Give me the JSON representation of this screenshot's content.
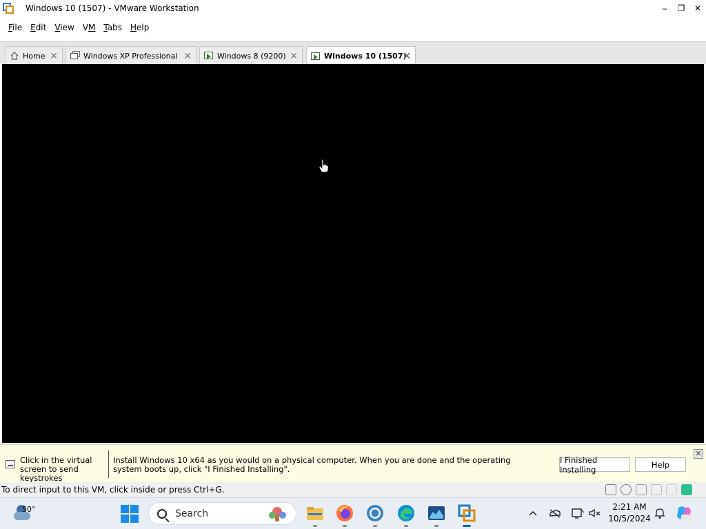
{
  "window": {
    "title": "Windows 10 (1507) - VMware Workstation",
    "controls": [
      "–",
      "❐",
      "✕"
    ]
  },
  "menu": {
    "items": [
      {
        "label": "File",
        "accel": "F"
      },
      {
        "label": "Edit",
        "accel": "E"
      },
      {
        "label": "View",
        "accel": "V"
      },
      {
        "label": "VM",
        "accel": "M"
      },
      {
        "label": "Tabs",
        "accel": "T"
      },
      {
        "label": "Help",
        "accel": "H"
      }
    ]
  },
  "tabs": [
    {
      "label": "Home",
      "icon": "home-icon",
      "active": false
    },
    {
      "label": "Windows XP Professional",
      "icon": "vm-icon",
      "active": false
    },
    {
      "label": "Windows 8 (9200)",
      "icon": "vm-running-icon",
      "active": false
    },
    {
      "label": "Windows 10 (1507)",
      "icon": "vm-running-icon",
      "active": true
    }
  ],
  "infobar": {
    "hint": "Click in the virtual screen to send keystrokes",
    "message": "Install Windows 10 x64 as you would on a physical computer. When you are done and the operating system boots up, click \"I Finished Installing\".",
    "finished_button": "I Finished Installing",
    "help_button": "Help"
  },
  "statusbar": {
    "text": "To direct input to this VM, click inside or press Ctrl+G."
  },
  "taskbar": {
    "weather_temp": "50°",
    "search_label": "Search",
    "apps": [
      "file-explorer-icon",
      "firefox-icon",
      "chrome-icon",
      "edge-icon",
      "app-icon",
      "vmware-icon"
    ],
    "clock_time": "2:21 AM",
    "clock_date": "10/5/2024"
  },
  "colors": {
    "vm_screen": "#000000",
    "infobar_bg": "#fdfde3",
    "accent": "#1a8ae8"
  }
}
